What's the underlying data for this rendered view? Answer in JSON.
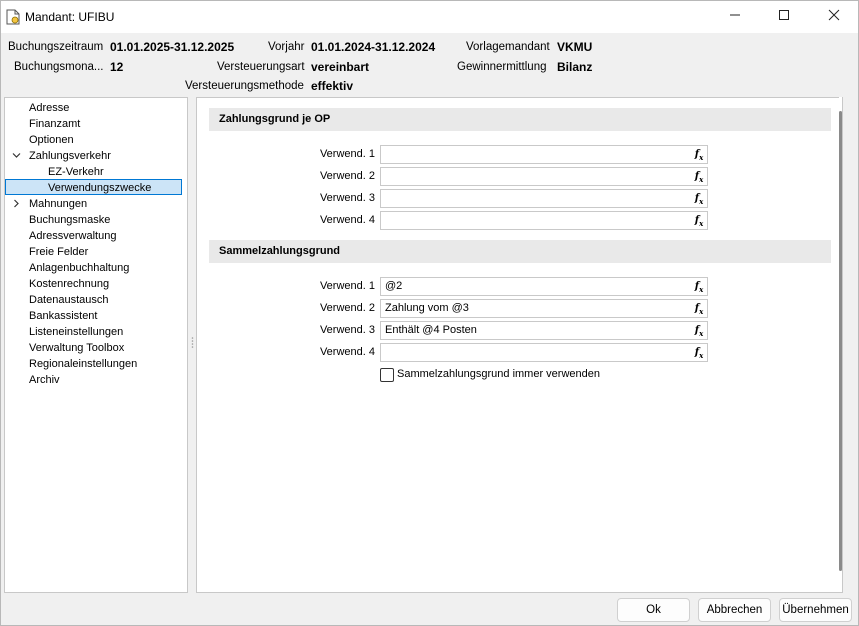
{
  "window": {
    "title": "Mandant: UFIBU"
  },
  "header": {
    "buchungszeitraum_label": "Buchungszeitraum",
    "buchungszeitraum_value": "01.01.2025-31.12.2025",
    "vorjahr_label": "Vorjahr",
    "vorjahr_value": "01.01.2024-31.12.2024",
    "vorlagemandant_label": "Vorlagemandant",
    "vorlagemandant_value": "VKMU",
    "buchungsmonat_label": "Buchungsmona...",
    "buchungsmonat_value": "12",
    "versteuerungsart_label": "Versteuerungsart",
    "versteuerungsart_value": "vereinbart",
    "gewinnermittlung_label": "Gewinnermittlung",
    "gewinnermittlung_value": "Bilanz",
    "versteuerungsmethode_label": "Versteuerungsmethode",
    "versteuerungsmethode_value": "effektiv"
  },
  "tree": {
    "items": [
      {
        "label": "Adresse"
      },
      {
        "label": "Finanzamt"
      },
      {
        "label": "Optionen"
      },
      {
        "label": "Zahlungsverkehr"
      },
      {
        "label": "EZ-Verkehr"
      },
      {
        "label": "Verwendungszwecke"
      },
      {
        "label": "Mahnungen"
      },
      {
        "label": "Buchungsmaske"
      },
      {
        "label": "Adressverwaltung"
      },
      {
        "label": "Freie Felder"
      },
      {
        "label": "Anlagenbuchhaltung"
      },
      {
        "label": "Kostenrechnung"
      },
      {
        "label": "Datenaustausch"
      },
      {
        "label": "Bankassistent"
      },
      {
        "label": "Listeneinstellungen"
      },
      {
        "label": "Verwaltung Toolbox"
      },
      {
        "label": "Regionaleinstellungen"
      },
      {
        "label": "Archiv"
      }
    ],
    "selected": "Verwendungszwecke"
  },
  "content": {
    "section1": {
      "title": "Zahlungsgrund je OP",
      "rows": [
        {
          "label": "Verwend. 1",
          "value": ""
        },
        {
          "label": "Verwend. 2",
          "value": ""
        },
        {
          "label": "Verwend. 3",
          "value": ""
        },
        {
          "label": "Verwend. 4",
          "value": ""
        }
      ]
    },
    "section2": {
      "title": "Sammelzahlungsgrund",
      "rows": [
        {
          "label": "Verwend. 1",
          "value": "@2"
        },
        {
          "label": "Verwend. 2",
          "value": "Zahlung vom @3"
        },
        {
          "label": "Verwend. 3",
          "value": "Enthält @4 Posten"
        },
        {
          "label": "Verwend. 4",
          "value": ""
        }
      ]
    },
    "checkbox": {
      "label": "Sammelzahlungsgrund immer verwenden",
      "checked": false
    },
    "fx_icon": "function-icon"
  },
  "buttons": {
    "ok": "Ok",
    "cancel": "Abbrechen",
    "apply": "Übernehmen"
  },
  "colors": {
    "selection_bg": "#cce4f7",
    "selection_border": "#0078d4",
    "section_bg": "#e9e9e9"
  }
}
